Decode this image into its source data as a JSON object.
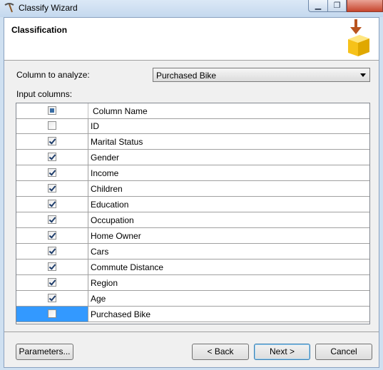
{
  "window": {
    "title": "Classify Wizard"
  },
  "header": {
    "title": "Classification"
  },
  "analyze": {
    "label": "Column to analyze:",
    "selected": "Purchased Bike"
  },
  "input": {
    "label": "Input columns:"
  },
  "grid": {
    "header_name": "Column Name",
    "rows": [
      {
        "name": "ID",
        "checked": false
      },
      {
        "name": "Marital Status",
        "checked": true
      },
      {
        "name": "Gender",
        "checked": true
      },
      {
        "name": "Income",
        "checked": true
      },
      {
        "name": "Children",
        "checked": true
      },
      {
        "name": "Education",
        "checked": true
      },
      {
        "name": "Occupation",
        "checked": true
      },
      {
        "name": "Home Owner",
        "checked": true
      },
      {
        "name": "Cars",
        "checked": true
      },
      {
        "name": "Commute Distance",
        "checked": true
      },
      {
        "name": "Region",
        "checked": true
      },
      {
        "name": "Age",
        "checked": true
      },
      {
        "name": "Purchased Bike",
        "checked": false,
        "selected": true
      }
    ]
  },
  "buttons": {
    "parameters": "Parameters...",
    "back": "< Back",
    "next": "Next >",
    "cancel": "Cancel"
  },
  "icons": {
    "app": "pickaxe-icon",
    "header": "arrow-down-cube-icon"
  },
  "colors": {
    "selection": "#3399ff"
  }
}
